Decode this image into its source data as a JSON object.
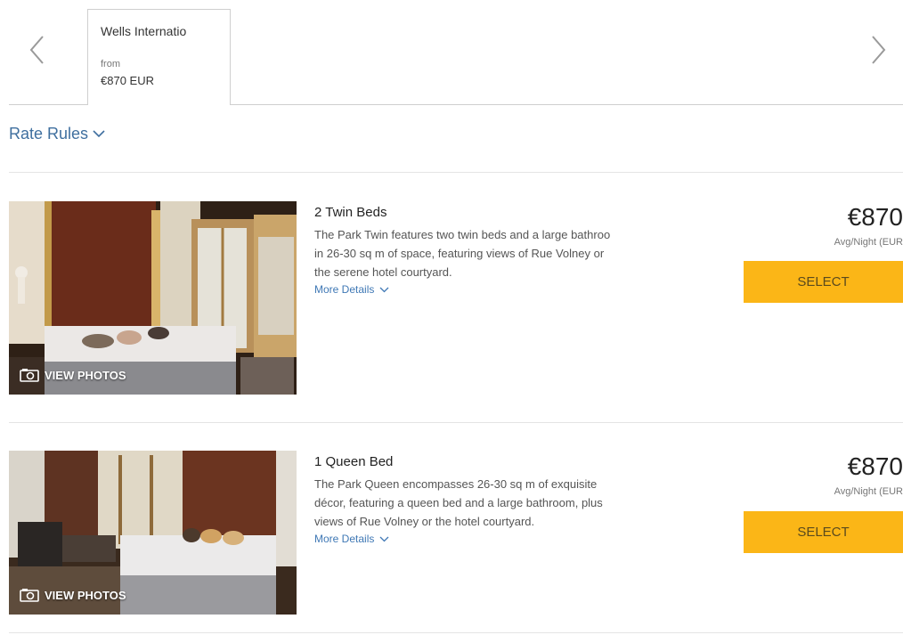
{
  "rate_tab": {
    "name": "Wells Internatio",
    "from_label": "from",
    "price": "€870 EUR"
  },
  "rate_rules": {
    "label": "Rate Rules"
  },
  "rooms": [
    {
      "title": "2 Twin Beds",
      "description_lines": [
        "The Park Twin features two twin beds and a large bathroo",
        "in 26-30 sq m of space, featuring views of Rue Volney or",
        "the serene hotel courtyard."
      ],
      "more_details": "More Details",
      "view_photos": "VIEW PHOTOS",
      "price": "€870",
      "price_note": "Avg/Night (EUR",
      "select_label": "SELECT"
    },
    {
      "title": "1 Queen Bed",
      "description_lines": [
        "The Park Queen encompasses 26-30 sq m of exquisite",
        "décor, featuring a queen bed and a large bathroom, plus",
        "views of Rue Volney or the hotel courtyard."
      ],
      "more_details": "More Details",
      "view_photos": "VIEW PHOTOS",
      "price": "€870",
      "price_note": "Avg/Night (EUR",
      "select_label": "SELECT"
    }
  ],
  "colors": {
    "accent_button": "#fbb617",
    "link": "#3f78b5",
    "rate_rules": "#3f6f9f"
  },
  "icons": {
    "prev": "chevron-left-icon",
    "next": "chevron-right-icon",
    "photo": "camera-icon",
    "expand": "chevron-down-icon"
  }
}
